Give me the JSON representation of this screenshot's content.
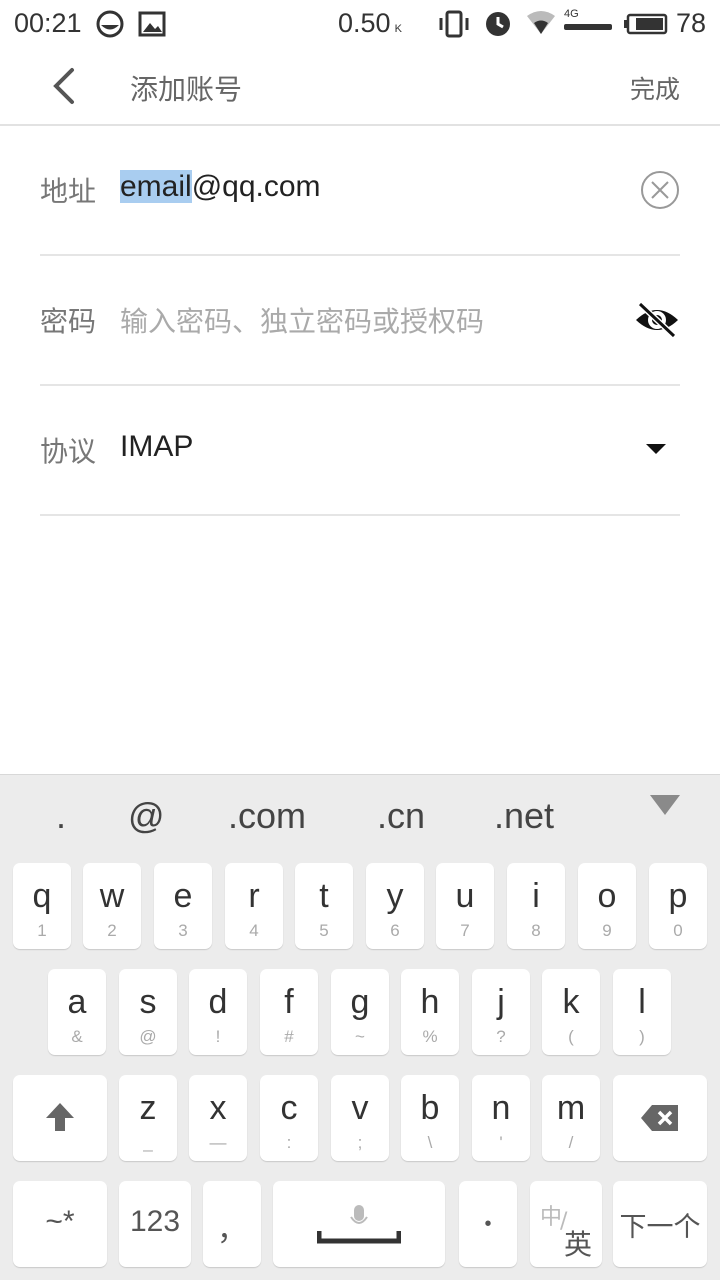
{
  "status": {
    "time": "00:21",
    "speed": "0.50",
    "speed_unit": "K",
    "net": "4G",
    "battery": "78"
  },
  "appbar": {
    "title": "添加账号",
    "done": "完成"
  },
  "form": {
    "address_label": "地址",
    "address_selected": "email",
    "address_rest": "@qq.com",
    "password_label": "密码",
    "password_placeholder": "输入密码、独立密码或授权码",
    "protocol_label": "协议",
    "protocol_value": "IMAP"
  },
  "keyboard": {
    "suggestions": [
      ".",
      "@",
      ".com",
      ".cn",
      ".net"
    ],
    "row1": [
      {
        "m": "q",
        "s": "1"
      },
      {
        "m": "w",
        "s": "2"
      },
      {
        "m": "e",
        "s": "3"
      },
      {
        "m": "r",
        "s": "4"
      },
      {
        "m": "t",
        "s": "5"
      },
      {
        "m": "y",
        "s": "6"
      },
      {
        "m": "u",
        "s": "7"
      },
      {
        "m": "i",
        "s": "8"
      },
      {
        "m": "o",
        "s": "9"
      },
      {
        "m": "p",
        "s": "0"
      }
    ],
    "row2": [
      {
        "m": "a",
        "s": "&"
      },
      {
        "m": "s",
        "s": "@"
      },
      {
        "m": "d",
        "s": "!"
      },
      {
        "m": "f",
        "s": "#"
      },
      {
        "m": "g",
        "s": "~"
      },
      {
        "m": "h",
        "s": "%"
      },
      {
        "m": "j",
        "s": "?"
      },
      {
        "m": "k",
        "s": "("
      },
      {
        "m": "l",
        "s": ")"
      }
    ],
    "row3": [
      {
        "m": "z",
        "s": "_"
      },
      {
        "m": "x",
        "s": "—"
      },
      {
        "m": "c",
        "s": ":"
      },
      {
        "m": "v",
        "s": ";"
      },
      {
        "m": "b",
        "s": "\\"
      },
      {
        "m": "n",
        "s": "'"
      },
      {
        "m": "m",
        "s": "/"
      }
    ],
    "symbols_key": "~*",
    "num_key": "123",
    "comma_key": "，",
    "dot_key": "•",
    "lang_key_top": "中",
    "lang_key_bottom": "英",
    "next_key": "下一个"
  }
}
